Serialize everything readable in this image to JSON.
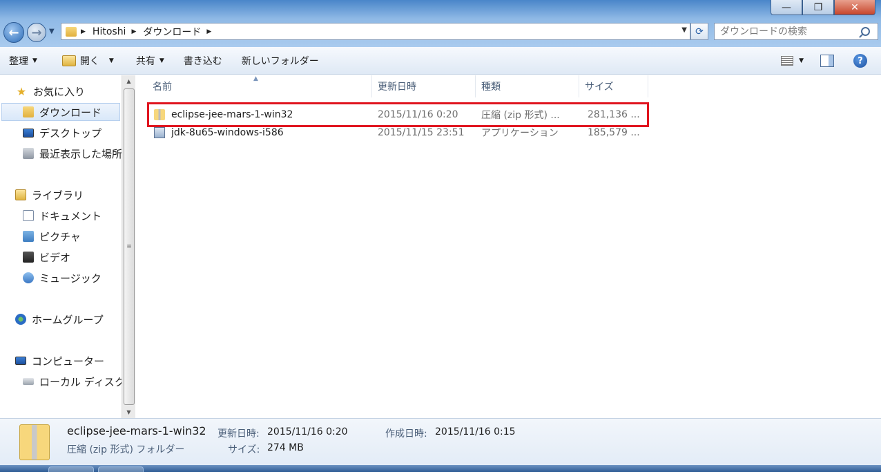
{
  "window": {
    "controls": {
      "minimize": "—",
      "maximize": "❐",
      "close": "✕"
    }
  },
  "address": {
    "crumbs": [
      "Hitoshi",
      "ダウンロード"
    ]
  },
  "search": {
    "placeholder": "ダウンロードの検索"
  },
  "toolbar": {
    "organize": "整理",
    "open": "開く",
    "share": "共有",
    "burn": "書き込む",
    "new_folder": "新しいフォルダー"
  },
  "sidebar": {
    "favorites": "お気に入り",
    "downloads": "ダウンロード",
    "desktop": "デスクトップ",
    "recent": "最近表示した場所",
    "libraries": "ライブラリ",
    "documents": "ドキュメント",
    "pictures": "ピクチャ",
    "videos": "ビデオ",
    "music": "ミュージック",
    "homegroup": "ホームグループ",
    "computer": "コンピューター",
    "local_disk": "ローカル ディスク"
  },
  "columns": {
    "name": "名前",
    "date": "更新日時",
    "type": "種類",
    "size": "サイズ"
  },
  "files": [
    {
      "name": "eclipse-jee-mars-1-win32",
      "date": "2015/11/16 0:20",
      "type": "圧縮 (zip 形式) ...",
      "size": "281,136 ..."
    },
    {
      "name": "jdk-8u65-windows-i586",
      "date": "2015/11/15 23:51",
      "type": "アプリケーション",
      "size": "185,579 ..."
    }
  ],
  "details": {
    "name": "eclipse-jee-mars-1-win32",
    "modified_label": "更新日時:",
    "modified_value": "2015/11/16 0:20",
    "created_label": "作成日時:",
    "created_value": "2015/11/16 0:15",
    "type": "圧縮 (zip 形式) フォルダー",
    "size_label": "サイズ:",
    "size_value": "274 MB"
  },
  "colors": {
    "highlight": "#e0141e",
    "titlebar": "#4a86c9"
  }
}
